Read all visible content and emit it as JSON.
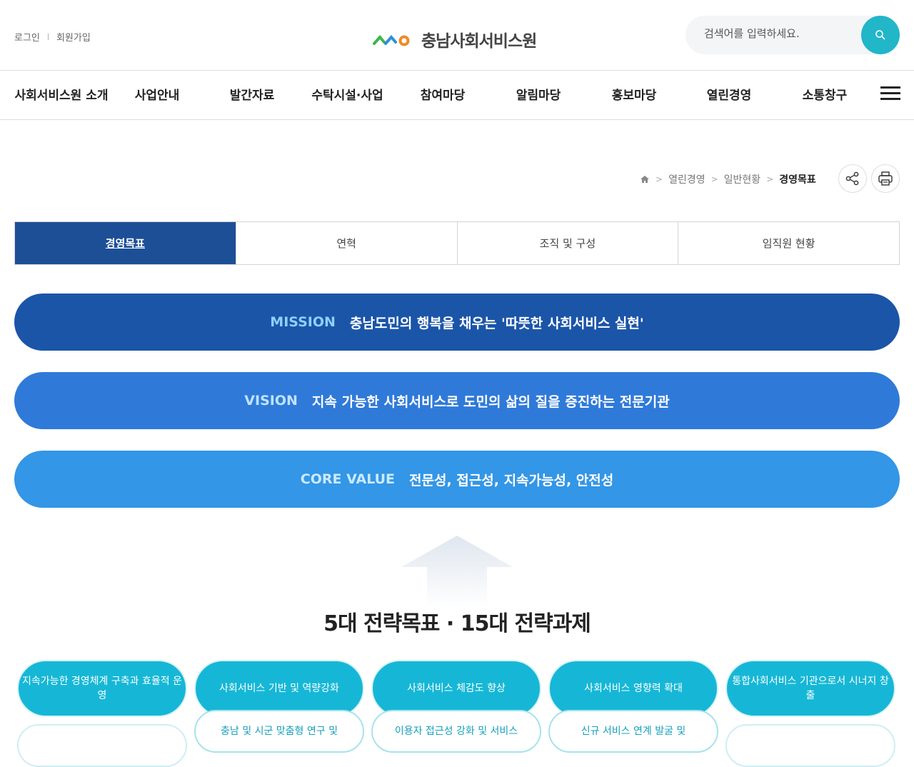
{
  "util": {
    "login": "로그인",
    "join": "회원가입"
  },
  "logo": {
    "text": "충남사회서비스원"
  },
  "search": {
    "placeholder": "검색어를 입력하세요."
  },
  "gnb": {
    "items": [
      "사회서비스원 소개",
      "사업안내",
      "발간자료",
      "수탁시설·사업",
      "참여마당",
      "알림마당",
      "홍보마당",
      "열린경영",
      "소통창구"
    ]
  },
  "breadcrumb": {
    "items": [
      "열린경영",
      "일반현황"
    ],
    "current": "경영목표"
  },
  "tabs": [
    "경영목표",
    "연혁",
    "조직 및 구성",
    "임직원 현황"
  ],
  "mission": {
    "key": "MISSION",
    "text": "충남도민의 행복을 채우는 '따뜻한 사회서비스 실현'"
  },
  "vision": {
    "key": "VISION",
    "text": "지속 가능한 사회서비스로 도민의 삶의 질을 증진하는 전문기관"
  },
  "core_value": {
    "key": "CORE VALUE",
    "text": "전문성, 접근성, 지속가능성, 안전성"
  },
  "strategy": {
    "title": "5대 전략목표 · 15대 전략과제",
    "goals": [
      "지속가능한 경영체계 구축과 효율적 운영",
      "사회서비스 기반 및 역량강화",
      "사회서비스 체감도 향상",
      "사회서비스 영향력 확대",
      "통합사회서비스 기관으로서 시너지 창출"
    ],
    "tasks": [
      "충남 및 시군 맞춤형 연구 및",
      "이용자 접근성 강화 및 서비스",
      "신규 서비스 연계 발굴 및"
    ]
  },
  "colors": {
    "mission": "#1b55a8",
    "vision": "#2f7ad9",
    "core": "#3396e6",
    "tab_active": "#1d4f97",
    "accent": "#22b6c9"
  }
}
